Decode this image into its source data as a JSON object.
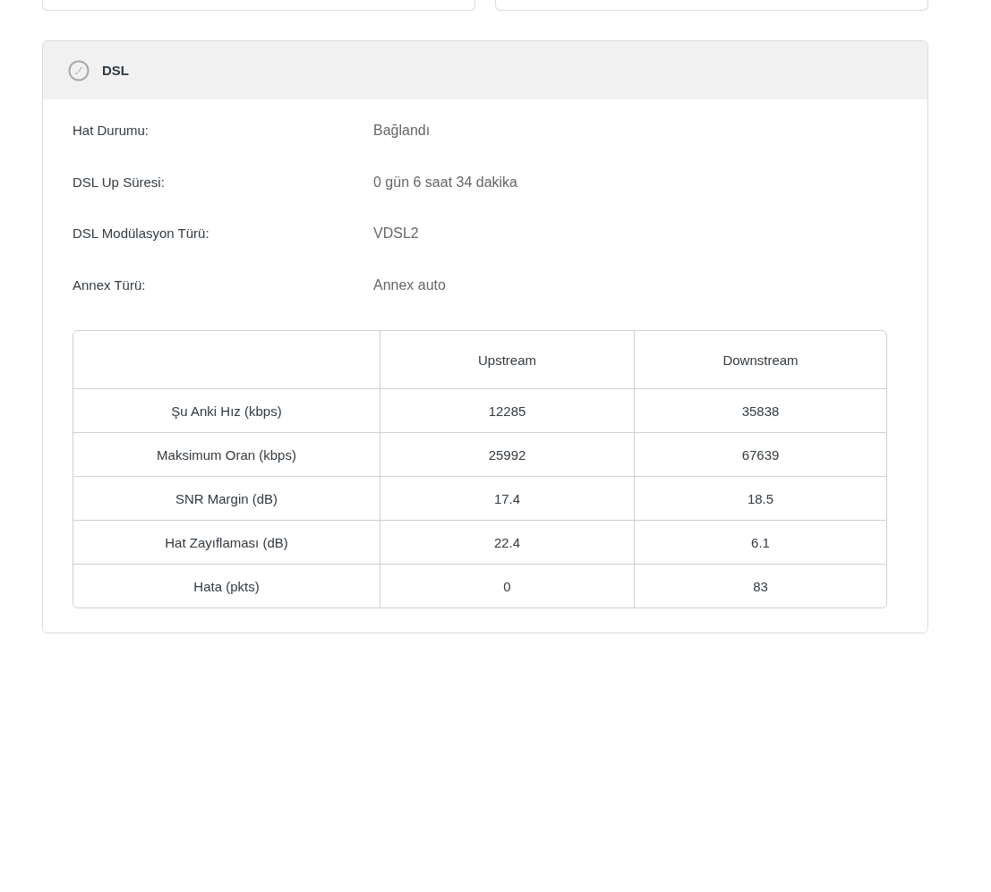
{
  "panel": {
    "title": "DSL",
    "fields": [
      {
        "label": "Hat Durumu:",
        "value": "Bağlandı"
      },
      {
        "label": "DSL Up Süresi:",
        "value": "0 gün 6 saat 34 dakika"
      },
      {
        "label": "DSL Modülasyon Türü:",
        "value": "VDSL2"
      },
      {
        "label": "Annex Türü:",
        "value": "Annex auto"
      }
    ],
    "table": {
      "columns": [
        "Upstream",
        "Downstream"
      ],
      "rows": [
        {
          "label": "Şu Anki Hız (kbps)",
          "upstream": "12285",
          "downstream": "35838"
        },
        {
          "label": "Maksimum Oran (kbps)",
          "upstream": "25992",
          "downstream": "67639"
        },
        {
          "label": "SNR Margin (dB)",
          "upstream": "17.4",
          "downstream": "18.5"
        },
        {
          "label": "Hat Zayıflaması (dB)",
          "upstream": "22.4",
          "downstream": "6.1"
        },
        {
          "label": "Hata (pkts)",
          "upstream": "0",
          "downstream": "83"
        }
      ]
    }
  }
}
